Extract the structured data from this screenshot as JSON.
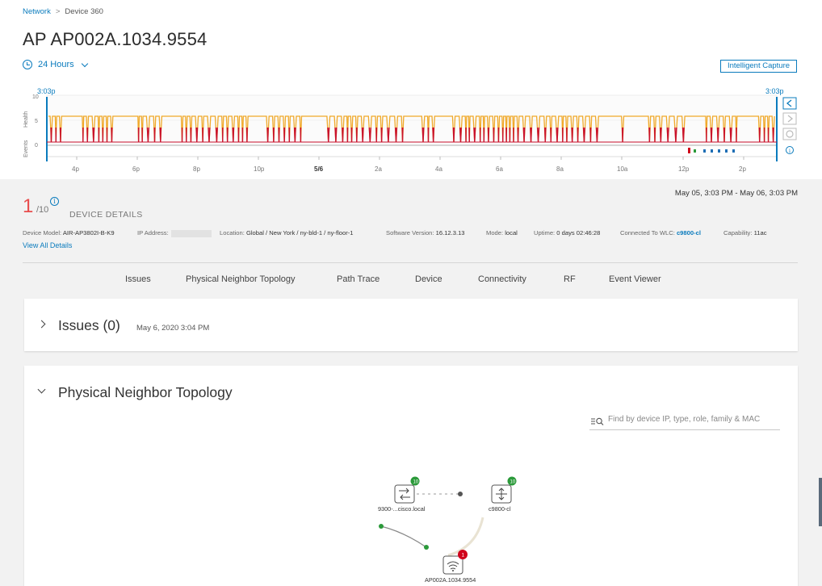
{
  "breadcrumb": {
    "parent": "Network",
    "current": "Device 360"
  },
  "page_title": "AP AP002A.1034.9554",
  "time_range_selector": "24 Hours",
  "intelligent_capture_label": "Intelligent Capture",
  "timeline": {
    "start_time": "3:03p",
    "end_time": "3:03p",
    "y_axis": {
      "health_label": "Health",
      "events_label": "Events",
      "ticks": [
        "10",
        "5",
        "0"
      ]
    },
    "x_ticks": [
      "4p",
      "6p",
      "8p",
      "10p",
      "5/6",
      "2a",
      "4a",
      "6a",
      "8a",
      "10a",
      "12p",
      "2p"
    ],
    "colors": {
      "health_high": "#f0a92a",
      "health_low": "#c9102e",
      "cursor": "#0a7bbd",
      "event_red": "#d0021b",
      "event_green": "#2b9a3a",
      "event_blue": "#1f6fb5"
    }
  },
  "device_details": {
    "health_score": "1",
    "health_denominator": "/10",
    "info_glyph": "i",
    "title": "DEVICE DETAILS",
    "date_range": "May 05, 3:03 PM - May 06, 3:03 PM",
    "fields": {
      "model_label": "Device Model:",
      "model_value": "AIR-AP3802I-B-K9",
      "ip_label": "IP Address:",
      "location_label": "Location:",
      "location_value": "Global / New York / ny-bld-1 / ny-floor-1",
      "software_label": "Software Version:",
      "software_value": "16.12.3.13",
      "mode_label": "Mode:",
      "mode_value": "local",
      "uptime_label": "Uptime:",
      "uptime_value": "0 days 02:46:28",
      "wlc_label": "Connected To WLC:",
      "wlc_value": "c9800-cl",
      "capability_label": "Capability:",
      "capability_value": "11ac"
    },
    "view_all": "View All Details"
  },
  "tabs": [
    "Issues",
    "Physical Neighbor Topology",
    "Path Trace",
    "Device",
    "Connectivity",
    "RF",
    "Event Viewer"
  ],
  "issues_card": {
    "title": "Issues (0)",
    "timestamp": "May 6, 2020 3:04 PM"
  },
  "topology_card": {
    "title": "Physical Neighbor Topology",
    "filter_placeholder": "Find by device IP, type, role, family & MAC",
    "nodes": [
      {
        "label": "9300-...cisco.local",
        "score": "10",
        "icon": "switch-icon",
        "status_color": "#2b9a3a"
      },
      {
        "label": "c9800-cl",
        "score": "10",
        "icon": "wlc-icon",
        "status_color": "#2b9a3a"
      },
      {
        "label": "AP002A.1034.9554",
        "score": "1",
        "icon": "access-point-icon",
        "status_color": "#d0021b"
      }
    ]
  }
}
